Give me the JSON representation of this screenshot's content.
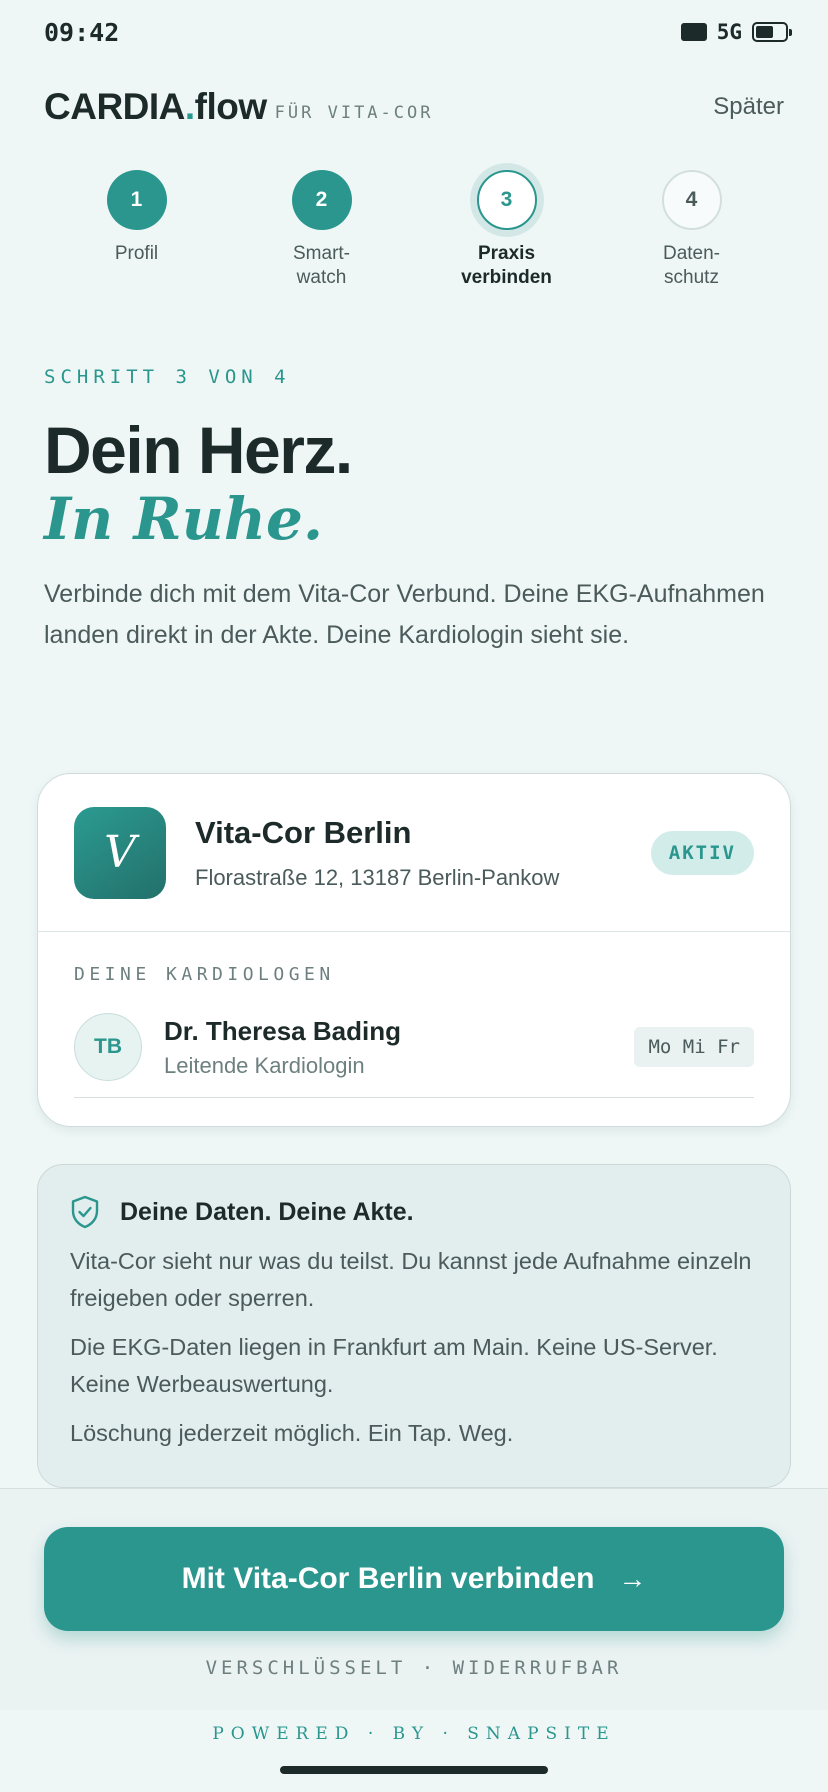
{
  "status_bar": {
    "time": "09:42",
    "network": "5G"
  },
  "header": {
    "brand_main": "CARDIA",
    "brand_dot": ".",
    "brand_suffix": "flow",
    "brand_sub": "FÜR VITA-COR",
    "later_label": "Später"
  },
  "stepper": {
    "steps": [
      {
        "number": "1",
        "label": "Profil",
        "state": "done"
      },
      {
        "number": "2",
        "label": "Smart-\nwatch",
        "state": "done"
      },
      {
        "number": "3",
        "label": "Praxis\nverbinden",
        "state": "active"
      },
      {
        "number": "4",
        "label": "Daten-\nschutz",
        "state": "todo"
      }
    ]
  },
  "hero": {
    "eyebrow": "SCHRITT 3 VON 4",
    "headline": "Dein Herz.",
    "headline_accent": "In Ruhe.",
    "intro": "Verbinde dich mit dem Vita-Cor Verbund. Deine EKG-Aufnahmen landen direkt in der Akte. Deine Kardiologin sieht sie."
  },
  "practice": {
    "logo_letter": "V",
    "name": "Vita-Cor Berlin",
    "address": "Florastraße 12, 13187 Berlin-Pankow",
    "status": "AKTIV",
    "doctors_label": "DEINE KARDIOLOGEN",
    "doctor": {
      "initials": "TB",
      "name": "Dr. Theresa Bading",
      "role": "Leitende Kardiologin",
      "days": "Mo Mi Fr"
    }
  },
  "privacy": {
    "title": "Deine Daten. Deine Akte.",
    "paragraphs": [
      "Vita-Cor sieht nur was du teilst. Du kannst jede Aufnahme einzeln freigeben oder sperren.",
      "Die EKG-Daten liegen in Frankfurt am Main. Keine US-Server. Keine Werbeauswertung.",
      "Löschung jederzeit möglich. Ein Tap. Weg."
    ]
  },
  "footer": {
    "cta_label": "Mit Vita-Cor Berlin verbinden",
    "cta_arrow": "→",
    "note": "VERSCHLÜSSELT · WIDERRUFBAR",
    "powered": "POWERED · BY · SNAPSITE"
  },
  "colors": {
    "accent": "#2a968d",
    "background": "#eef7f6",
    "text": "#1d2a2a",
    "muted": "#4b5a5a"
  },
  "icons": {
    "privacy": "shield-check-icon",
    "cta": "arrow-right-icon",
    "signal": "signal-icon",
    "battery": "battery-icon"
  }
}
